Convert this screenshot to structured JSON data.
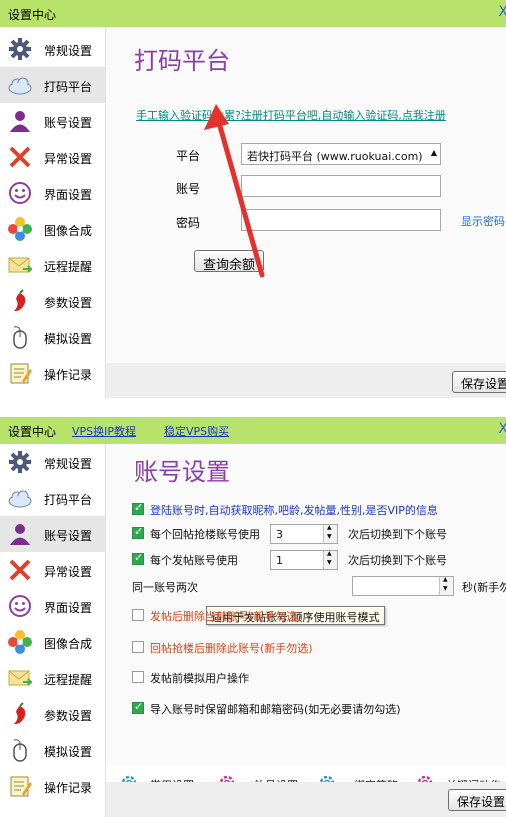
{
  "sidebar": {
    "items": [
      {
        "label": "常规设置",
        "icon": "gear-icon"
      },
      {
        "label": "打码平台",
        "icon": "cloud-icon"
      },
      {
        "label": "账号设置",
        "icon": "user-icon"
      },
      {
        "label": "异常设置",
        "icon": "red-x-icon"
      },
      {
        "label": "界面设置",
        "icon": "smiley-icon"
      },
      {
        "label": "图像合成",
        "icon": "flower-icon"
      },
      {
        "label": "远程提醒",
        "icon": "envelope-icon"
      },
      {
        "label": "参数设置",
        "icon": "pepper-icon"
      },
      {
        "label": "模拟设置",
        "icon": "mouse-icon"
      },
      {
        "label": "操作记录",
        "icon": "notepad-icon"
      }
    ]
  },
  "window1": {
    "title": "设置中心",
    "close": "X",
    "active_item": "打码平台",
    "heading": "打码平台",
    "promo_link": "手工输入验证码太累?注册打码平台吧,自动输入验证码,点我注册",
    "platform_label": "平台",
    "platform_value": "若快打码平台  (www.ruokuai.com)",
    "account_label": "账号",
    "account_value": "",
    "password_label": "密码",
    "password_value": "",
    "show_password": "显示密码",
    "query_button": "查询余额",
    "save_button": "保存设置"
  },
  "window2": {
    "title": "设置中心",
    "close": "X",
    "link_vps_tutorial": "VPS换IP教程",
    "link_vps_buy": "稳定VPS购买",
    "active_item": "账号设置",
    "heading": "账号设置",
    "options": {
      "opt1": {
        "checked": true,
        "text": "登陆账号时,自动获取昵称,吧龄,发帖量,性别,是否VIP的信息"
      },
      "opt2": {
        "checked": true,
        "text": "每个回帖抢楼账号使用",
        "value": "3",
        "suffix": "次后切换到下个账号"
      },
      "opt3": {
        "checked": true,
        "text": "每个发帖账号使用",
        "value": "1",
        "suffix": "次后切换到下个账号"
      },
      "opt4": {
        "label": "同一账号两次",
        "suffix": "秒(新手勿改)"
      },
      "opt5": {
        "checked": false,
        "text": "发帖后删除当前账号(新手勿选)"
      },
      "opt6": {
        "checked": false,
        "text": "回帖抢楼后删除此账号(新手勿选)"
      },
      "opt7": {
        "checked": false,
        "text": "发帖前模拟用户操作"
      },
      "opt8": {
        "checked": true,
        "text": "导入账号时保留邮箱和邮箱密码(如无必要请勿勾选)"
      }
    },
    "tooltip": "适用于发帖账号,顺序使用账号模式",
    "tabs": [
      "常用设置",
      "补号设置",
      "绑定策略",
      "关键词动作"
    ],
    "save_button": "保存设置"
  },
  "colors": {
    "titlebar": "#b8e36a",
    "heading": "#8b3ea8",
    "promo": "#008c7a",
    "arrow": "#e4312b",
    "checkbox": "#2fa84f"
  }
}
